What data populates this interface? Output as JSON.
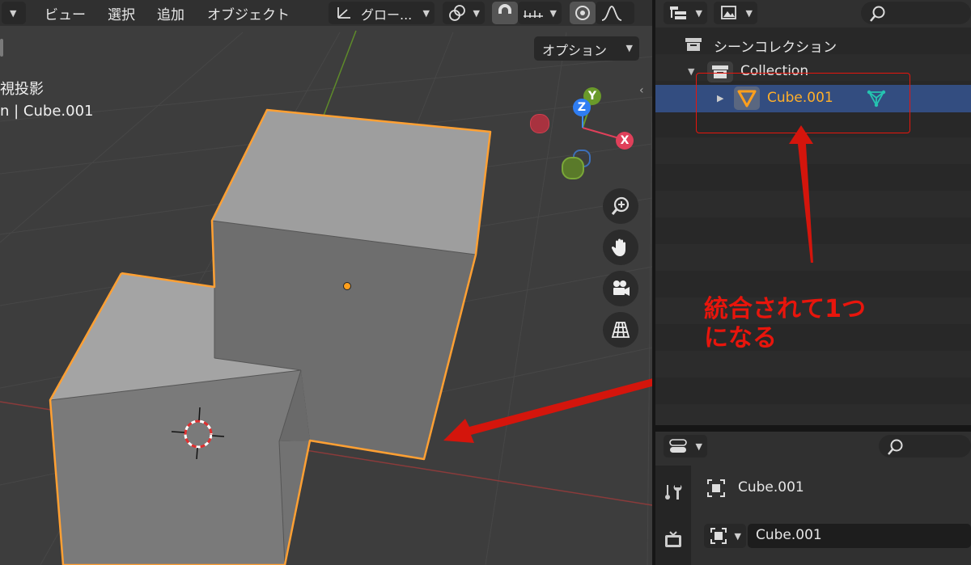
{
  "viewport": {
    "menu": [
      "ビュー",
      "選択",
      "追加",
      "オブジェクト"
    ],
    "transform_orientation": "グロー...",
    "options_label": "オプション",
    "overlay_lines": [
      "視投影",
      "n | Cube.001"
    ],
    "gizmo": {
      "x": "X",
      "y": "Y",
      "z": "Z"
    },
    "nav_icons": [
      "zoom-icon",
      "hand-pan-icon",
      "camera-icon",
      "perspective-grid-icon"
    ]
  },
  "outliner": {
    "scene_collection": "シーンコレクション",
    "collection": "Collection",
    "object": "Cube.001",
    "mesh_icon": "mesh-data-icon"
  },
  "properties": {
    "object_name": "Cube.001",
    "data_name": "Cube.001"
  },
  "annotation": {
    "line1": "統合されて1つ",
    "line2": "になる",
    "color": "#e8150c"
  },
  "colors": {
    "selection_outline": "#ffa033",
    "selected_row": "#334d80",
    "object_text": "#ffaf29"
  }
}
